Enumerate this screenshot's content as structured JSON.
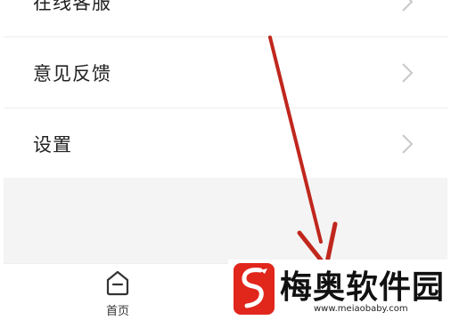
{
  "menu": {
    "items": [
      {
        "label": "在线客服"
      },
      {
        "label": "意见反馈"
      },
      {
        "label": "设置"
      }
    ]
  },
  "bottom_nav": {
    "tabs": [
      {
        "label": "首页",
        "icon": "home-icon"
      }
    ]
  },
  "annotation": {
    "arrow_color": "#c0271d"
  },
  "watermark": {
    "title": "梅奥软件园",
    "url": "www.meiaobaby.com",
    "logo_color": "#e1261c"
  }
}
